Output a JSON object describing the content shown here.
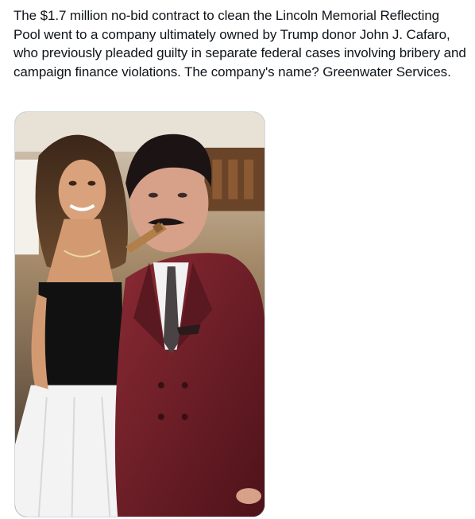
{
  "tweet": {
    "text": "The $1.7 million no-bid contract to clean the Lincoln Memorial Reflecting Pool went to a company ultimately owned by Trump donor John J. Cafaro, who previously pleaded guilty in separate federal cases involving bribery and campaign finance violations. The company's name? Greenwater Services."
  },
  "media": {
    "type": "photo"
  },
  "colors": {
    "text": "#0f1419",
    "background": "#ffffff",
    "media_border": "#cfd9de",
    "blazer": "#6e1f28",
    "dress_top": "#111111",
    "skirt": "#f3f3f3"
  }
}
